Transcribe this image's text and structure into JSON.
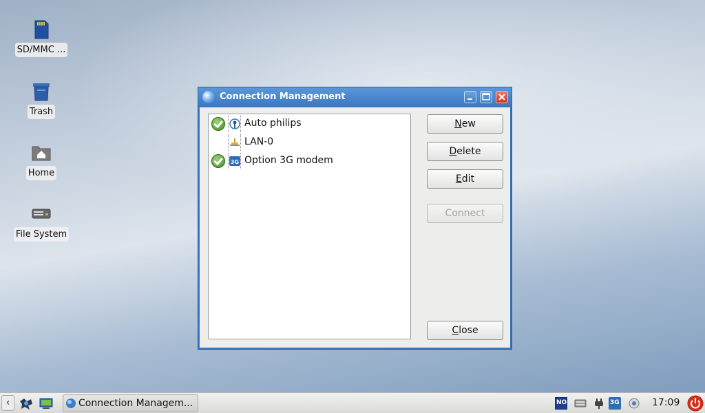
{
  "desktop": {
    "icons": [
      {
        "label": "SD/MMC ...",
        "icon": "sd-card-icon"
      },
      {
        "label": "Trash",
        "icon": "trash-icon"
      },
      {
        "label": "Home",
        "icon": "home-folder-icon"
      },
      {
        "label": "File System",
        "icon": "drive-icon"
      }
    ]
  },
  "window": {
    "title": "Connection Management",
    "controls": [
      "minimize",
      "maximize",
      "close"
    ],
    "connections": [
      {
        "name": "Auto philips",
        "active": true,
        "type": "wireless-icon"
      },
      {
        "name": "LAN-0",
        "active": false,
        "type": "lan-icon"
      },
      {
        "name": "Option 3G modem",
        "active": true,
        "type": "3g-modem-icon"
      }
    ],
    "buttons": {
      "new": {
        "mnemonic": "N",
        "rest": "ew"
      },
      "delete": {
        "mnemonic": "D",
        "rest": "elete"
      },
      "edit": {
        "mnemonic": "E",
        "rest": "dit"
      },
      "connect": {
        "label": "Connect",
        "disabled": true
      },
      "close": {
        "mnemonic": "C",
        "rest": "lose"
      }
    }
  },
  "taskbar": {
    "task_label": "Connection Managem...",
    "tray": {
      "keyboard_layout": "NO",
      "network_3g": "3G"
    },
    "clock": "17:09"
  },
  "colors": {
    "window_frame": "#3b77c2",
    "title_text": "#ffffff",
    "check_green": "#3e8a1e",
    "power_red": "#d9301c"
  }
}
